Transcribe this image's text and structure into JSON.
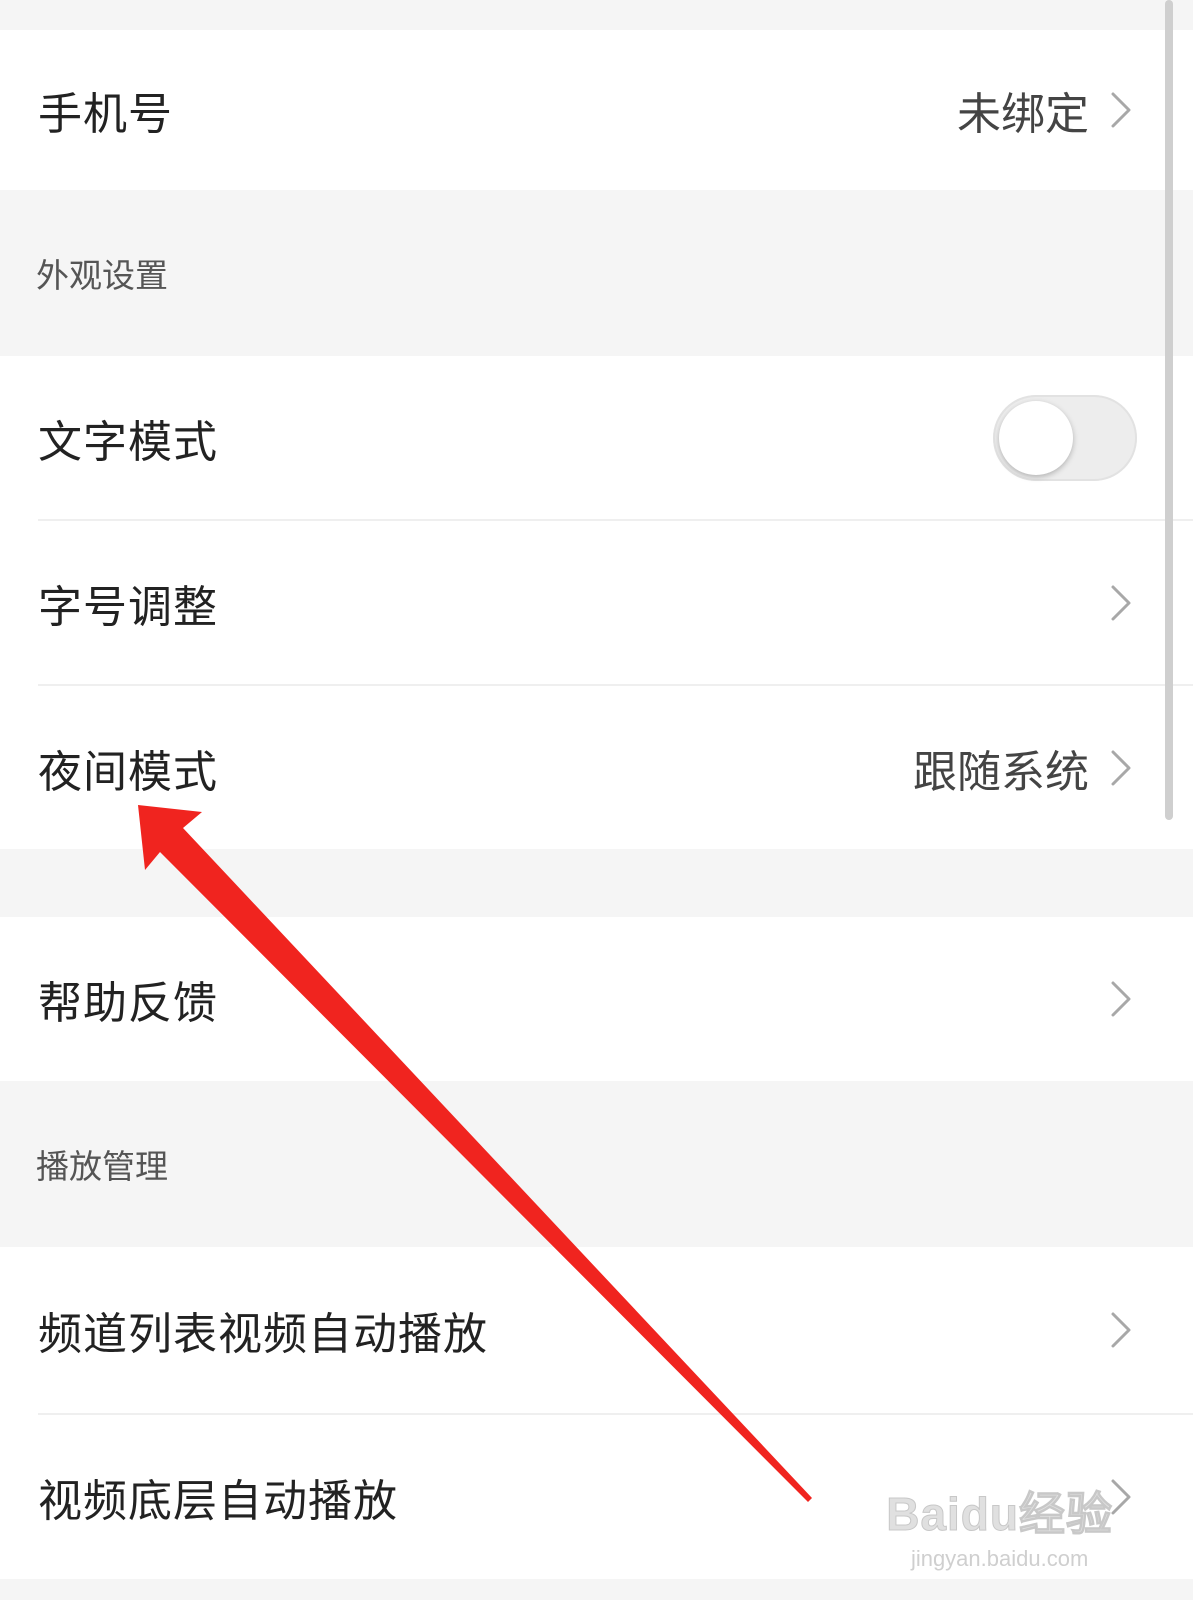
{
  "account": {
    "phone_label": "手机号",
    "phone_value": "未绑定"
  },
  "appearance": {
    "section_title": "外观设置",
    "text_mode_label": "文字模式",
    "text_mode_enabled": false,
    "font_size_label": "字号调整",
    "night_mode_label": "夜间模式",
    "night_mode_value": "跟随系统"
  },
  "help": {
    "feedback_label": "帮助反馈"
  },
  "playback": {
    "section_title": "播放管理",
    "channel_autoplay_label": "频道列表视频自动播放",
    "bottom_autoplay_label": "视频底层自动播放"
  },
  "watermark": {
    "main": "Baidu经验",
    "sub": "jingyan.baidu.com"
  },
  "colors": {
    "annotation_arrow": "#f0241f",
    "page_bg": "#f5f5f5",
    "row_bg": "#ffffff"
  },
  "icons": {
    "chevron": "chevron-right-icon",
    "annotation": "red-arrow-annotation"
  }
}
